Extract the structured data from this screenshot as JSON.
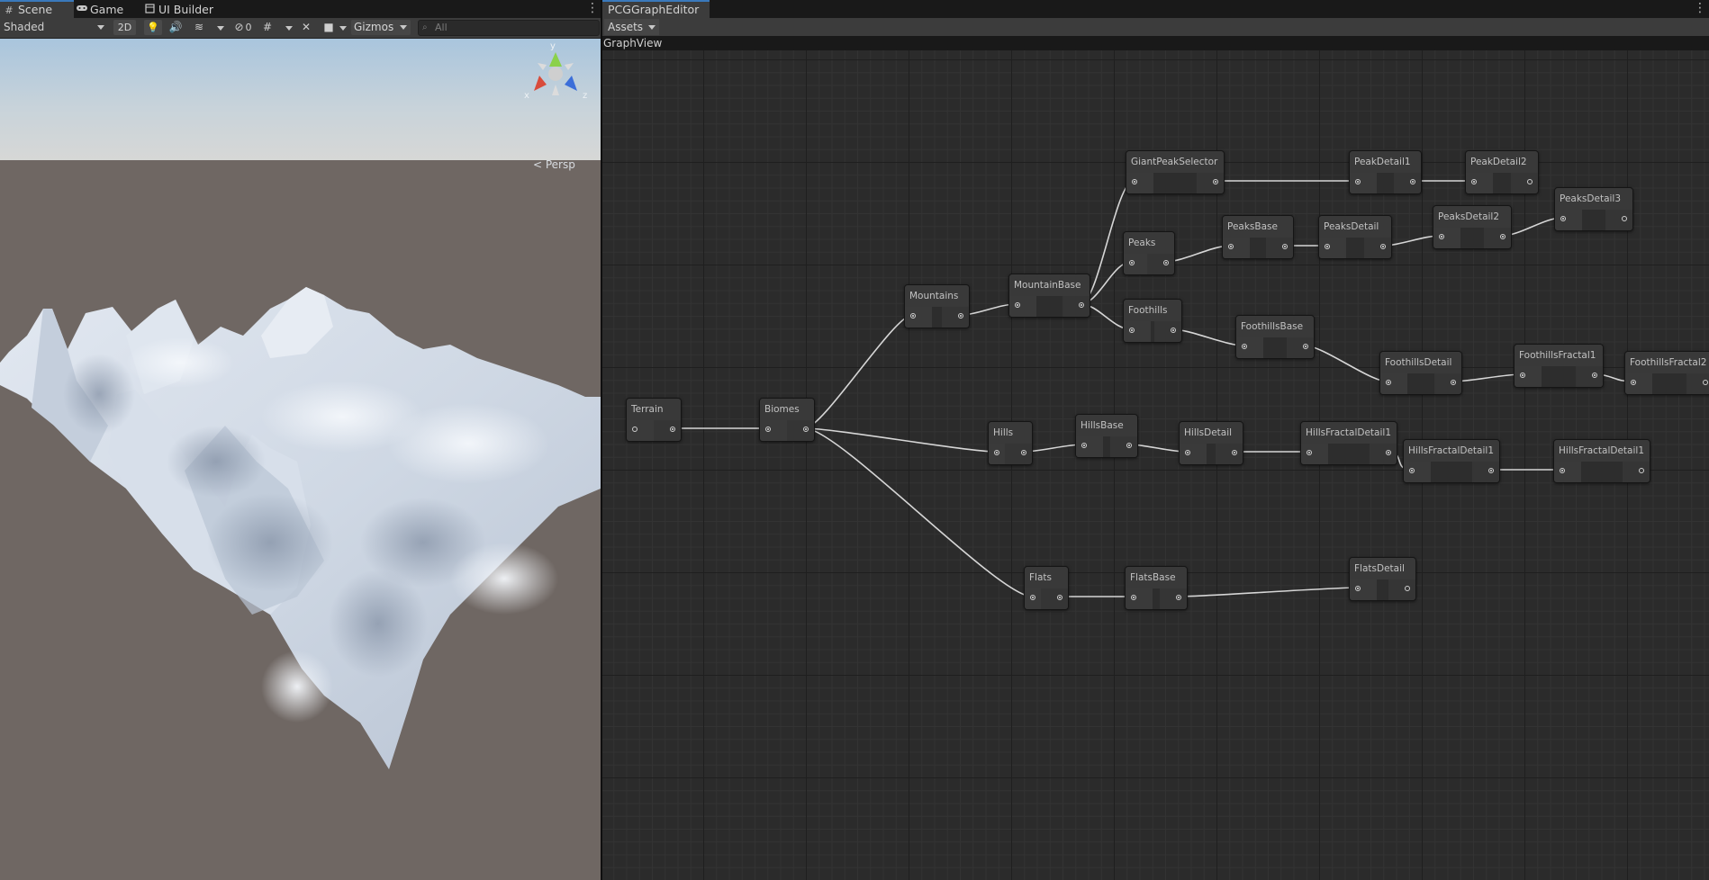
{
  "scene": {
    "tabs": [
      {
        "label": "Scene",
        "icon": "grid-icon"
      },
      {
        "label": "Game",
        "icon": "gamepad-icon"
      },
      {
        "label": "UI Builder",
        "icon": "ui-builder-icon"
      }
    ],
    "toolbar": {
      "shading_mode": "Shaded",
      "mode_2d_label": "2D",
      "hidden_count": "0",
      "gizmos_label": "Gizmos",
      "search_placeholder": "All"
    },
    "gizmo": {
      "y_label": "y",
      "x_label": "x",
      "z_label": "z",
      "projection_label": "< Persp"
    }
  },
  "graph": {
    "tab_label": "PCGGraphEditor",
    "assets_label": "Assets",
    "view_label": "GraphView",
    "nodes": [
      {
        "id": "terrain",
        "title": "Terrain"
      },
      {
        "id": "biomes",
        "title": "Biomes"
      },
      {
        "id": "mountains",
        "title": "Mountains"
      },
      {
        "id": "mountainbase",
        "title": "MountainBase"
      },
      {
        "id": "giantpeakselector",
        "title": "GiantPeakSelector"
      },
      {
        "id": "peakdetail1",
        "title": "PeakDetail1"
      },
      {
        "id": "peakdetail2",
        "title": "PeakDetail2"
      },
      {
        "id": "peaks",
        "title": "Peaks"
      },
      {
        "id": "peaksbase",
        "title": "PeaksBase"
      },
      {
        "id": "peaksdetail",
        "title": "PeaksDetail"
      },
      {
        "id": "peaksdetail2",
        "title": "PeaksDetail2"
      },
      {
        "id": "peaksdetail3",
        "title": "PeaksDetail3"
      },
      {
        "id": "foothills",
        "title": "Foothills"
      },
      {
        "id": "foothillsbase",
        "title": "FoothillsBase"
      },
      {
        "id": "foothillsdetail",
        "title": "FoothillsDetail"
      },
      {
        "id": "foothillsfractal1",
        "title": "FoothillsFractal1"
      },
      {
        "id": "foothillsfractal2",
        "title": "FoothillsFractal2"
      },
      {
        "id": "hills",
        "title": "Hills"
      },
      {
        "id": "hillsbase",
        "title": "HillsBase"
      },
      {
        "id": "hillsdetail",
        "title": "HillsDetail"
      },
      {
        "id": "hillsfractaldetail1",
        "title": "HillsFractalDetail1"
      },
      {
        "id": "hillsfractaldetail1b",
        "title": "HillsFractalDetail1"
      },
      {
        "id": "hillsfractaldetail1c",
        "title": "HillsFractalDetail1"
      },
      {
        "id": "flats",
        "title": "Flats"
      },
      {
        "id": "flatsbase",
        "title": "FlatsBase"
      },
      {
        "id": "flatsdetail",
        "title": "FlatsDetail"
      }
    ],
    "edges": [
      [
        "terrain",
        "biomes"
      ],
      [
        "biomes",
        "mountains"
      ],
      [
        "biomes",
        "hills"
      ],
      [
        "biomes",
        "flats"
      ],
      [
        "mountains",
        "mountainbase"
      ],
      [
        "mountainbase",
        "giantpeakselector"
      ],
      [
        "mountainbase",
        "peaks"
      ],
      [
        "mountainbase",
        "foothills"
      ],
      [
        "giantpeakselector",
        "peakdetail1"
      ],
      [
        "peakdetail1",
        "peakdetail2"
      ],
      [
        "peaks",
        "peaksbase"
      ],
      [
        "peaksbase",
        "peaksdetail"
      ],
      [
        "peaksdetail",
        "peaksdetail2"
      ],
      [
        "peaksdetail2",
        "peaksdetail3"
      ],
      [
        "foothills",
        "foothillsbase"
      ],
      [
        "foothillsbase",
        "foothillsdetail"
      ],
      [
        "foothillsdetail",
        "foothillsfractal1"
      ],
      [
        "foothillsfractal1",
        "foothillsfractal2"
      ],
      [
        "hills",
        "hillsbase"
      ],
      [
        "hillsbase",
        "hillsdetail"
      ],
      [
        "hillsdetail",
        "hillsfractaldetail1"
      ],
      [
        "hillsfractaldetail1",
        "hillsfractaldetail1b"
      ],
      [
        "hillsfractaldetail1b",
        "hillsfractaldetail1c"
      ],
      [
        "flats",
        "flatsbase"
      ],
      [
        "flatsbase",
        "flatsdetail"
      ]
    ]
  }
}
